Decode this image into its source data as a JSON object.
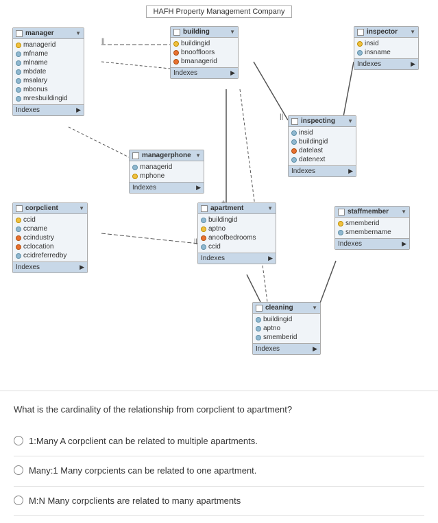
{
  "diagram": {
    "title": "HAFH Property Management Company",
    "tables": {
      "manager": {
        "label": "manager",
        "fields": [
          {
            "name": "managerid",
            "icon": "pk"
          },
          {
            "name": "mfname",
            "icon": "regular"
          },
          {
            "name": "mlname",
            "icon": "regular"
          },
          {
            "name": "mbdate",
            "icon": "regular"
          },
          {
            "name": "msalary",
            "icon": "regular"
          },
          {
            "name": "mbonus",
            "icon": "regular"
          },
          {
            "name": "mresbuildingid",
            "icon": "regular"
          }
        ],
        "footer": "Indexes"
      },
      "building": {
        "label": "building",
        "fields": [
          {
            "name": "buildingid",
            "icon": "pk"
          },
          {
            "name": "bnooffloors",
            "icon": "fk"
          },
          {
            "name": "bmanagerid",
            "icon": "fk"
          }
        ],
        "footer": "Indexes"
      },
      "inspector": {
        "label": "inspector",
        "fields": [
          {
            "name": "insid",
            "icon": "pk"
          },
          {
            "name": "insname",
            "icon": "regular"
          }
        ],
        "footer": "Indexes"
      },
      "inspecting": {
        "label": "inspecting",
        "fields": [
          {
            "name": "insid",
            "icon": "regular"
          },
          {
            "name": "buildingid",
            "icon": "regular"
          },
          {
            "name": "datelast",
            "icon": "fk"
          },
          {
            "name": "datenext",
            "icon": "regular"
          }
        ],
        "footer": "Indexes"
      },
      "managerphone": {
        "label": "managerphone",
        "fields": [
          {
            "name": "managerid",
            "icon": "regular"
          },
          {
            "name": "mphone",
            "icon": "pk"
          }
        ],
        "footer": "Indexes"
      },
      "corpclient": {
        "label": "corpclient",
        "fields": [
          {
            "name": "ccid",
            "icon": "pk"
          },
          {
            "name": "ccname",
            "icon": "regular"
          },
          {
            "name": "ccindustry",
            "icon": "fk"
          },
          {
            "name": "cclocation",
            "icon": "fk"
          },
          {
            "name": "ccidreferredby",
            "icon": "regular"
          }
        ],
        "footer": "Indexes"
      },
      "apartment": {
        "label": "apartment",
        "fields": [
          {
            "name": "buildingid",
            "icon": "regular"
          },
          {
            "name": "aptno",
            "icon": "pk"
          },
          {
            "name": "anoofbedrooms",
            "icon": "fk"
          },
          {
            "name": "ccid",
            "icon": "regular"
          }
        ],
        "footer": "Indexes"
      },
      "staffmember": {
        "label": "staffmember",
        "fields": [
          {
            "name": "smemberid",
            "icon": "pk"
          },
          {
            "name": "smembername",
            "icon": "regular"
          }
        ],
        "footer": "Indexes"
      },
      "cleaning": {
        "label": "cleaning",
        "fields": [
          {
            "name": "buildingid",
            "icon": "regular"
          },
          {
            "name": "aptno",
            "icon": "regular"
          },
          {
            "name": "smemberid",
            "icon": "regular"
          }
        ],
        "footer": "Indexes"
      }
    }
  },
  "question": {
    "text": "What is the cardinality of the relationship from corpclient to apartment?",
    "options": [
      {
        "id": "a",
        "text": "1:Many A corpclient can be related to multiple apartments."
      },
      {
        "id": "b",
        "text": "Many:1 Many corpcients can be related to one apartment."
      },
      {
        "id": "c",
        "text": "M:N Many corpclients are related to many apartments"
      }
    ]
  }
}
